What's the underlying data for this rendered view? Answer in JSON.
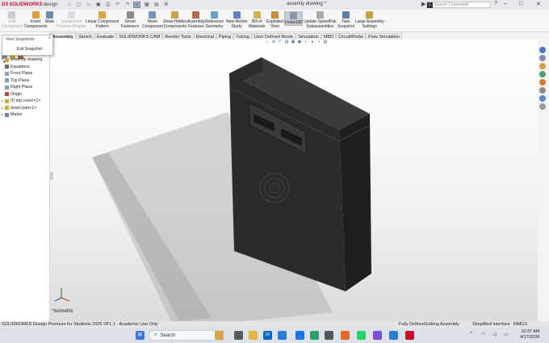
{
  "titlebar": {
    "brand_ds": "DS",
    "brand_name": "SOLIDWORKS",
    "brand_sub": "design",
    "document_title": "assemly drawing *",
    "search_placeholder": "Search Commands"
  },
  "ribbon": {
    "buttons": [
      {
        "id": "edit-component",
        "label": "Edit\nComponent",
        "disabled": true,
        "color": "#8b8fa3"
      },
      {
        "id": "insert-components",
        "label": "Insert\nComponents",
        "disabled": false,
        "color": "#e0a13a"
      },
      {
        "id": "mate",
        "label": "Mate",
        "disabled": false,
        "color": "#6d8ab3"
      },
      {
        "id": "component-preview",
        "label": "Component\nPreview Window",
        "disabled": true,
        "color": "#b0b8c8"
      },
      {
        "id": "linear-component-pattern",
        "label": "Linear Component\nPattern",
        "disabled": false,
        "color": "#d7a63f"
      },
      {
        "id": "smart-fasteners",
        "label": "Smart\nFasteners",
        "disabled": false,
        "color": "#8a8a8a"
      },
      {
        "id": "move-component",
        "label": "Move\nComponent",
        "disabled": false,
        "color": "#7a90b8"
      },
      {
        "id": "show-hidden",
        "label": "Show Hidden\nComponents",
        "disabled": false,
        "color": "#c9a446"
      },
      {
        "id": "assembly-features",
        "label": "Assembly\nFeatures",
        "disabled": false,
        "color": "#b36a4a"
      },
      {
        "id": "reference-geometry",
        "label": "Reference\nGeometry",
        "disabled": false,
        "color": "#6aa0c9"
      },
      {
        "id": "new-motion-study",
        "label": "New Motion\nStudy",
        "disabled": false,
        "color": "#5f86c0"
      },
      {
        "id": "bill-of-materials",
        "label": "Bill of\nMaterials",
        "disabled": false,
        "color": "#d8b04e"
      },
      {
        "id": "exploded-view",
        "label": "Exploded\nView",
        "disabled": false,
        "color": "#c38d3a"
      },
      {
        "id": "instant3d",
        "label": "Instant3D",
        "disabled": false,
        "color": "#8c97a8",
        "selected": true
      },
      {
        "id": "update-speedpak",
        "label": "Update SpeedPak\nSubassemblies",
        "disabled": false,
        "color": "#a9a9a9"
      },
      {
        "id": "take-snapshot",
        "label": "Take\nSnapshot",
        "disabled": false,
        "color": "#5f7fa6"
      },
      {
        "id": "large-assembly-settings",
        "label": "Large Assembly\nSettings",
        "disabled": false,
        "color": "#c5a03c"
      }
    ]
  },
  "tabs": [
    "Assembly",
    "Sketch",
    "Evaluate",
    "SOLIDWORKS CAM",
    "Render Tools",
    "Electrical",
    "Piping",
    "Tubing",
    "User Defined Route",
    "Simulation",
    "MBD",
    "CircuitWorks",
    "Flow Simulation"
  ],
  "popup": {
    "title": "View Snapshots",
    "button": "Exit Snapshot"
  },
  "tree": {
    "root": "assemly drawing",
    "items": [
      {
        "label": "Equations",
        "icon": "equations-icon",
        "color": "#6b6b6b"
      },
      {
        "label": "Front Plane",
        "icon": "plane-icon",
        "color": "#8a9bb5"
      },
      {
        "label": "Top Plane",
        "icon": "plane-icon",
        "color": "#8a9bb5"
      },
      {
        "label": "Right Plane",
        "icon": "plane-icon",
        "color": "#8a9bb5"
      },
      {
        "label": "Origin",
        "icon": "origin-icon",
        "color": "#c04a3a"
      },
      {
        "label": "(f) top cover<1>",
        "icon": "part-icon",
        "color": "#d4a43a",
        "arrow": true
      },
      {
        "label": "down part<1>",
        "icon": "part-icon",
        "color": "#d4a43a",
        "arrow": true
      },
      {
        "label": "Mates",
        "icon": "mates-icon",
        "color": "#6f7f99",
        "arrow": true
      }
    ]
  },
  "viewport": {
    "view_label": "*Isometric"
  },
  "statusbar": {
    "product": "SOLIDWORKS Design Premium for Students 2026 SP1.1 - Academic Use Only",
    "state": "Fully Defined",
    "mode": "Editing Assembly",
    "interface": "Simplified Interface",
    "units": "MMGS"
  },
  "taskbar": {
    "search_label": "Search",
    "time": "10:37 AM",
    "date": "4/17/2026"
  }
}
